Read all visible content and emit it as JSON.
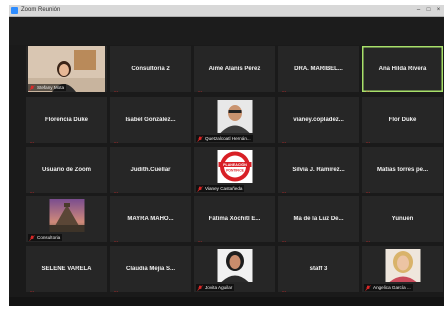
{
  "window": {
    "title": "Zoom Reunión",
    "min": "–",
    "max": "□",
    "close": "×"
  },
  "colors": {
    "tile_bg": "#262626",
    "active_border": "#a8e06a",
    "mute_red": "#e02828",
    "app_blue": "#2d8cff"
  },
  "tiles": [
    {
      "name": "",
      "label": "Stefany Mota"
    },
    {
      "name": "Consultoria 2"
    },
    {
      "name": "Aimé Alanís Pérez"
    },
    {
      "name": "DRA. MARIBEL..."
    },
    {
      "name": "Ana Hilda Rivera",
      "active": true
    },
    {
      "name": "Florencia Duke"
    },
    {
      "name": "Isabel González..."
    },
    {
      "name": "",
      "label": "Quetzalcoatl Hernán..."
    },
    {
      "name": "vianey.copladez..."
    },
    {
      "name": "Flor Duke"
    },
    {
      "name": "Usuario de Zoom"
    },
    {
      "name": "Judith.Cuellar"
    },
    {
      "name": "",
      "label": "Vianey Castañeda",
      "logo_top": "PLANEACIÓN",
      "logo_bottom": "PONTIFICE"
    },
    {
      "name": "Silvia J. Ramirez..."
    },
    {
      "name": "Matias torres pe..."
    },
    {
      "name": "",
      "label": "Consultoria"
    },
    {
      "name": "MAYRA MAHO..."
    },
    {
      "name": "Fátima Xóchitl E..."
    },
    {
      "name": "Ma de la Luz De..."
    },
    {
      "name": "Yunuen"
    },
    {
      "name": "SELENE VARELA"
    },
    {
      "name": "Claudia Mejía S..."
    },
    {
      "name": "",
      "label": "Jovita Aguilar"
    },
    {
      "name": "staff 3"
    },
    {
      "name": "",
      "label": "Angelica García ..."
    }
  ]
}
